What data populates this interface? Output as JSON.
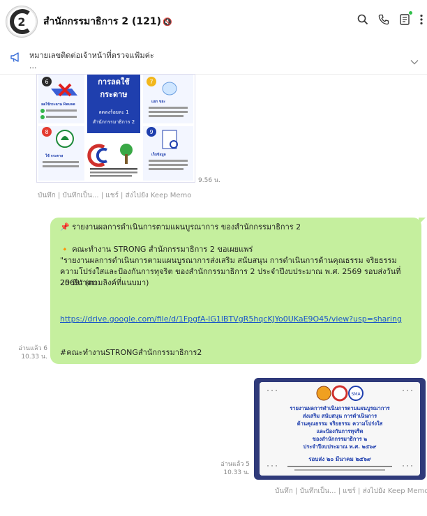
{
  "header": {
    "title": "สำนักกรรมาธิการ 2 (121)"
  },
  "announcement": {
    "text": "หมายเลขติดต่อเจ้าหน้าที่ตรวจแฟ้มค่ะ",
    "ellipsis": "..."
  },
  "image1": {
    "panel_text_1": "การลดใช้",
    "panel_text_2": "กระดาษ",
    "panel_sub_1": "ลดลงร้อยละ 1",
    "panel_sub_2": "สำนักกรรมาธิการ 2",
    "time": "9.56 น."
  },
  "actions1": {
    "text": "บันทึก | บันทึกเป็น... | แชร์ | ส่งไปยัง Keep Memo"
  },
  "message": {
    "line1": "📌 รายงานผลการดำเนินการตามแผนบูรณาการ ของสำนักกรรมาธิการ 2",
    "line2": "🔸 คณะทำงาน STRONG สำนักกรรมาธิการ 2 ขอเผยแพร่",
    "line3": "\"รายงานผลการดำเนินการตามแผนบูรณาการส่งเสริม สนับสนุน การดำเนินการด้านคุณธรรม จริยธรรม",
    "line4": "ความโปร่งใสและป้องกันการทุจริต ของสำนักกรรมาธิการ 2 ประจำปีงบประมาณ พ.ศ. 2569 รอบส่งวันที่ 20 มีนาคม",
    "line5": "2569\" (ตามลิงค์ที่แนบมา)",
    "link": "https://drive.google.com/file/d/1FpgfA-lG1lBTVgR5hqcKJYo0UKaE9O45/view?usp=sharing",
    "hashtag": "#คณะทำงานSTRONGสำนักกรรมาธิการ2",
    "read": "อ่านแล้ว 6",
    "time": "10.33 น."
  },
  "image2": {
    "poster_l1": "รายงานผลการดำเนินการตามแผนบูรณาการ",
    "poster_l2": "ส่งเสริม สนับสนุน การดำเนินการ",
    "poster_l3": "ด้านคุณธรรม จริยธรรม ความโปร่งใส",
    "poster_l4": "และป้องกันการทุจริต",
    "poster_l5": "ของสำนักกรรมาธิการ ๒",
    "poster_l6": "ประจำปีงบประมาณ พ.ศ. ๒๕๖๙",
    "poster_date": "รอบส่ง ๒๐ มีนาคม ๒๕๖๙",
    "read": "อ่านแล้ว 5",
    "time": "10.33 น."
  },
  "actions2": {
    "text": "บันทึก | บันทึกเป็น... | แชร์ | ส่งไปยัง Keep Memo"
  },
  "colors": {
    "bubble": "#c5ef9e",
    "link": "#1a56c8",
    "poster_frame": "#2f3a7a"
  }
}
